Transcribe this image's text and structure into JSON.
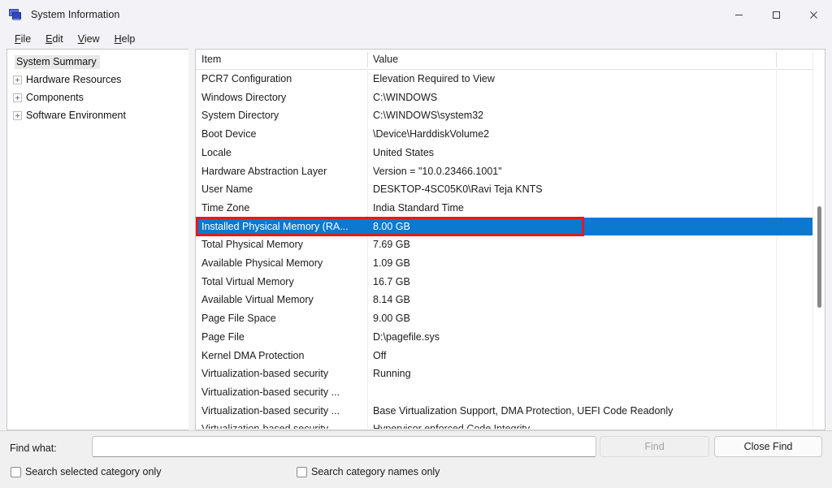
{
  "window": {
    "title": "System Information",
    "icon": "system-information-icon",
    "controls": {
      "minimize": "minimize-icon",
      "maximize": "maximize-icon",
      "close": "close-icon"
    }
  },
  "menubar": {
    "items": [
      {
        "label": "File",
        "accesskey": "F"
      },
      {
        "label": "Edit",
        "accesskey": "E"
      },
      {
        "label": "View",
        "accesskey": "V"
      },
      {
        "label": "Help",
        "accesskey": "H"
      }
    ]
  },
  "tree": {
    "items": [
      {
        "label": "System Summary",
        "expandable": false,
        "selected": true
      },
      {
        "label": "Hardware Resources",
        "expandable": true,
        "selected": false
      },
      {
        "label": "Components",
        "expandable": true,
        "selected": false
      },
      {
        "label": "Software Environment",
        "expandable": true,
        "selected": false
      }
    ]
  },
  "list": {
    "columns": [
      "Item",
      "Value"
    ],
    "selection_color": "#0b79d0",
    "annotation_color": "#e01b1b",
    "rows": [
      {
        "item": "PCR7 Configuration",
        "value": "Elevation Required to View"
      },
      {
        "item": "Windows Directory",
        "value": "C:\\WINDOWS"
      },
      {
        "item": "System Directory",
        "value": "C:\\WINDOWS\\system32"
      },
      {
        "item": "Boot Device",
        "value": "\\Device\\HarddiskVolume2"
      },
      {
        "item": "Locale",
        "value": "United States"
      },
      {
        "item": "Hardware Abstraction Layer",
        "value": "Version = \"10.0.23466.1001\""
      },
      {
        "item": "User Name",
        "value": "DESKTOP-4SC05K0\\Ravi Teja KNTS"
      },
      {
        "item": "Time Zone",
        "value": "India Standard Time"
      },
      {
        "item": "Installed Physical Memory (RA...",
        "value": "8.00 GB",
        "selected": true,
        "annotated": true
      },
      {
        "item": "Total Physical Memory",
        "value": "7.69 GB"
      },
      {
        "item": "Available Physical Memory",
        "value": "1.09 GB"
      },
      {
        "item": "Total Virtual Memory",
        "value": "16.7 GB"
      },
      {
        "item": "Available Virtual Memory",
        "value": "8.14 GB"
      },
      {
        "item": "Page File Space",
        "value": "9.00 GB"
      },
      {
        "item": "Page File",
        "value": "D:\\pagefile.sys"
      },
      {
        "item": "Kernel DMA Protection",
        "value": "Off"
      },
      {
        "item": "Virtualization-based security",
        "value": "Running"
      },
      {
        "item": "Virtualization-based security ...",
        "value": ""
      },
      {
        "item": "Virtualization-based security ...",
        "value": "Base Virtualization Support, DMA Protection, UEFI Code Readonly"
      },
      {
        "item": "Virtualization-based security ...",
        "value": "Hypervisor enforced Code Integrity",
        "clipped": true
      }
    ]
  },
  "scrollbar": {
    "name": "vertical-scrollbar"
  },
  "findbar": {
    "find_what_label": "Find what:",
    "search_value": "",
    "search_placeholder": "",
    "find_button": "Find",
    "find_button_disabled": true,
    "close_find_button": "Close Find",
    "checkboxes": [
      {
        "label": "Search selected category only",
        "checked": false
      },
      {
        "label": "Search category names only",
        "checked": false
      }
    ]
  }
}
